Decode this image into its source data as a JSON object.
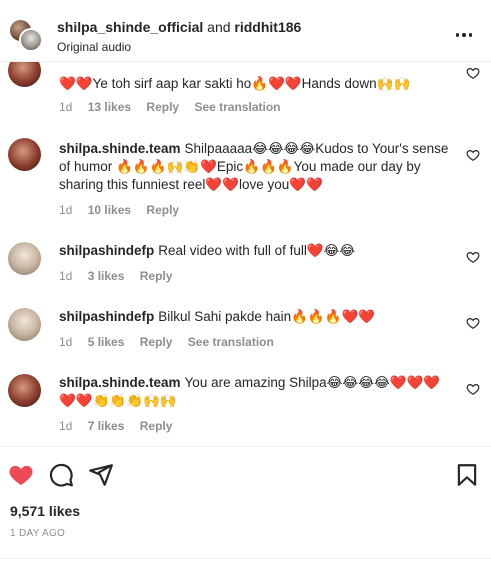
{
  "header": {
    "user1": "shilpa_shinde_official",
    "joiner": "and",
    "user2": "riddhit186",
    "subtitle": "Original audio",
    "more_icon": "more-horizontal-icon"
  },
  "comments": [
    {
      "user": "",
      "text": "❤️❤️Ye toh sirf aap kar sakti ho🔥❤️❤️Hands down🙌🙌",
      "time": "1d",
      "likes": "13 likes",
      "reply": "Reply",
      "translate": "See translation"
    },
    {
      "user": "shilpa.shinde.team",
      "text": "Shilpaaaaa😂😂😂😂Kudos to Your's sense of humor 🔥🔥🔥🙌👏❤️Epic🔥🔥🔥You made our day by sharing this funniest reel❤️❤️love you❤️❤️",
      "time": "1d",
      "likes": "10 likes",
      "reply": "Reply"
    },
    {
      "user": "shilpashindefp",
      "text": "Real video with full of full❤️😂😂",
      "time": "1d",
      "likes": "3 likes",
      "reply": "Reply"
    },
    {
      "user": "shilpashindefp",
      "text": "Bilkul Sahi pakde hain🔥🔥🔥❤️❤️",
      "time": "1d",
      "likes": "5 likes",
      "reply": "Reply",
      "translate": "See translation"
    },
    {
      "user": "shilpa.shinde.team",
      "text": "You are amazing Shilpa😂😂😂😂❤️❤️❤️❤️❤️👏👏👏🙌🙌",
      "time": "1d",
      "likes": "7 likes",
      "reply": "Reply"
    }
  ],
  "actions": {
    "like_icon": "heart-filled-icon",
    "comment_icon": "comment-icon",
    "share_icon": "share-icon",
    "save_icon": "bookmark-icon"
  },
  "likes_count": "9,571 likes",
  "post_date": "1 DAY AGO",
  "colors": {
    "like_red": "#ed4956",
    "text": "#262626",
    "muted": "#8e8e8e",
    "divider": "#efefef"
  }
}
